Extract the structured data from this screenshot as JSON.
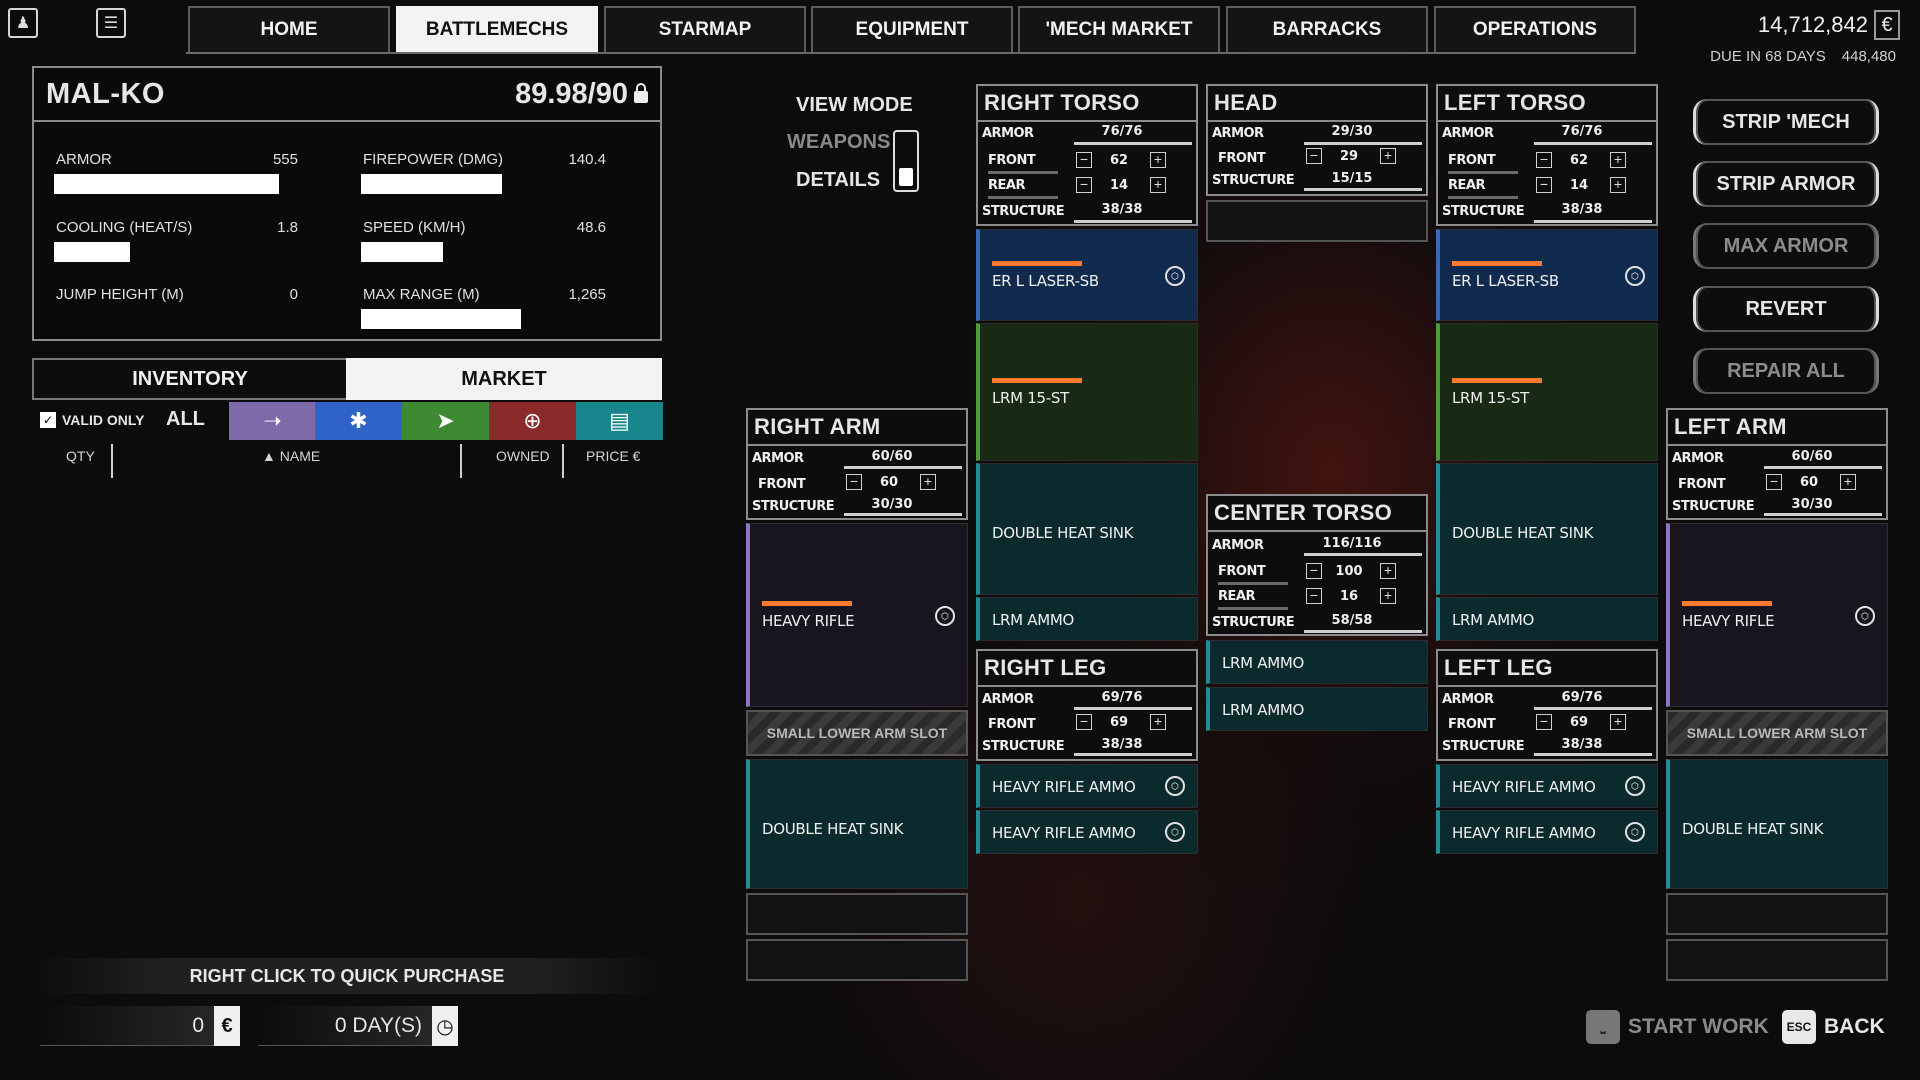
{
  "nav": {
    "tabs": [
      "HOME",
      "BATTLEMECHS",
      "STARMAP",
      "EQUIPMENT",
      "'MECH MARKET",
      "BARRACKS",
      "OPERATIONS"
    ],
    "active": "BATTLEMECHS"
  },
  "finance": {
    "cbills": "14,712,842",
    "due_label": "DUE IN 68 DAYS",
    "due_amount": "448,480"
  },
  "mech": {
    "name": "MAL-KO",
    "tonnage": "89.98/90",
    "stats": [
      {
        "label": "ARMOR",
        "value": "555"
      },
      {
        "label": "FIREPOWER (DMG)",
        "value": "140.4"
      },
      {
        "label": "COOLING (HEAT/S)",
        "value": "1.8"
      },
      {
        "label": "SPEED (KM/H)",
        "value": "48.6"
      },
      {
        "label": "JUMP HEIGHT (M)",
        "value": "0"
      },
      {
        "label": "MAX RANGE (M)",
        "value": "1,265"
      }
    ]
  },
  "inventory": {
    "tabs": [
      "INVENTORY",
      "MARKET"
    ],
    "active": "MARKET",
    "valid_only": "VALID ONLY",
    "all": "ALL",
    "columns": [
      "QTY",
      "NAME",
      "OWNED",
      "PRICE"
    ]
  },
  "quick_purchase": "RIGHT CLICK TO QUICK PURCHASE",
  "totals": {
    "cost": "0",
    "days": "0 DAY(S)"
  },
  "view_mode": {
    "title": "VIEW MODE",
    "option1": "WEAPONS",
    "option2": "DETAILS"
  },
  "labels": {
    "armor": "ARMOR",
    "front": "FRONT",
    "rear": "REAR",
    "structure": "STRUCTURE"
  },
  "locations": {
    "right_torso": {
      "title": "RIGHT TORSO",
      "armor": "76/76",
      "front": "62",
      "rear": "14",
      "structure": "38/38",
      "slots": [
        "ER L LASER-SB",
        "LRM 15-ST",
        "DOUBLE HEAT SINK",
        "LRM AMMO"
      ]
    },
    "head": {
      "title": "HEAD",
      "armor": "29/30",
      "front": "29",
      "structure": "15/15"
    },
    "left_torso": {
      "title": "LEFT TORSO",
      "armor": "76/76",
      "front": "62",
      "rear": "14",
      "structure": "38/38",
      "slots": [
        "ER L LASER-SB",
        "LRM 15-ST",
        "DOUBLE HEAT SINK",
        "LRM AMMO"
      ]
    },
    "right_arm": {
      "title": "RIGHT ARM",
      "armor": "60/60",
      "front": "60",
      "structure": "30/30",
      "slots": [
        "HEAVY RIFLE",
        "SMALL LOWER ARM SLOT",
        "DOUBLE HEAT SINK"
      ]
    },
    "left_arm": {
      "title": "LEFT ARM",
      "armor": "60/60",
      "front": "60",
      "structure": "30/30",
      "slots": [
        "HEAVY RIFLE",
        "SMALL LOWER ARM SLOT",
        "DOUBLE HEAT SINK"
      ]
    },
    "center_torso": {
      "title": "CENTER TORSO",
      "armor": "116/116",
      "front": "100",
      "rear": "16",
      "structure": "58/58",
      "slots": [
        "LRM AMMO",
        "LRM AMMO"
      ]
    },
    "right_leg": {
      "title": "RIGHT LEG",
      "armor": "69/76",
      "front": "69",
      "structure": "38/38",
      "slots": [
        "HEAVY RIFLE AMMO",
        "HEAVY RIFLE AMMO"
      ]
    },
    "left_leg": {
      "title": "LEFT LEG",
      "armor": "69/76",
      "front": "69",
      "structure": "38/38",
      "slots": [
        "HEAVY RIFLE AMMO",
        "HEAVY RIFLE AMMO"
      ]
    }
  },
  "actions": [
    "STRIP 'MECH",
    "STRIP ARMOR",
    "MAX ARMOR",
    "REVERT",
    "REPAIR ALL"
  ],
  "bottom": {
    "start_work": "START WORK",
    "esc_key": "ESC",
    "back": "BACK"
  },
  "colors": {
    "energy": "#112b4e",
    "missile": "#182a14",
    "support": "#0b2a2d",
    "ballistic": "#18151f",
    "ammo_bar": "#ff7a2e"
  }
}
